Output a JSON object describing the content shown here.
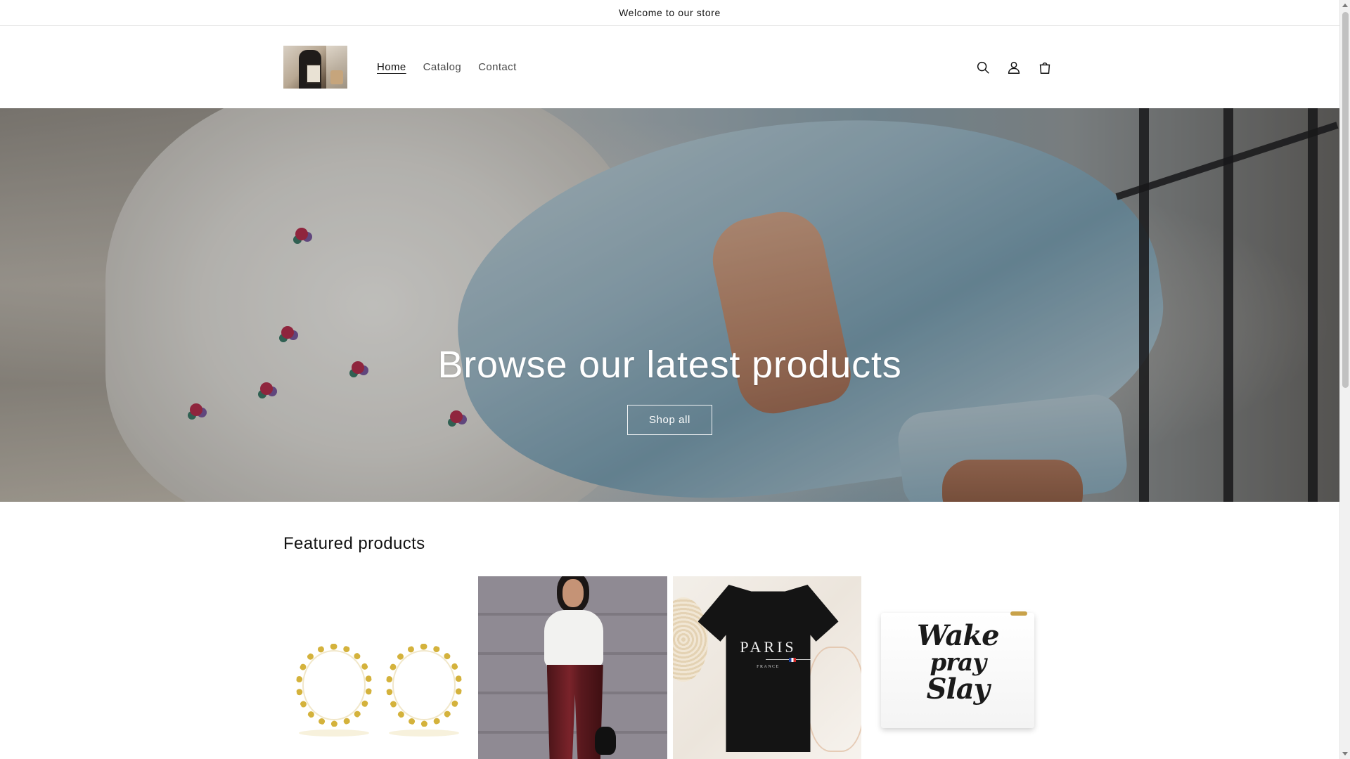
{
  "announcement": {
    "text": "Welcome to our store"
  },
  "header": {
    "logo_alt": "Store logo",
    "nav": [
      {
        "label": "Home",
        "active": true
      },
      {
        "label": "Catalog",
        "active": false
      },
      {
        "label": "Contact",
        "active": false
      }
    ],
    "icons": [
      "search-icon",
      "account-icon",
      "cart-icon"
    ]
  },
  "hero": {
    "title": "Browse our latest products",
    "button_label": "Shop all"
  },
  "featured": {
    "title": "Featured products",
    "products": [
      {
        "image": "gold-hoop-earrings"
      },
      {
        "image": "model-red-leather-pants"
      },
      {
        "image": "paris-black-tshirt",
        "print_main": "PARIS",
        "print_sub": "FRANCE"
      },
      {
        "image": "wake-pray-slay-pouch",
        "print_lines": [
          "Wake",
          "pray",
          "Slay"
        ]
      }
    ]
  },
  "colors": {
    "text": "#121212",
    "muted": "#4a4a4a",
    "accent_gold": "#d4b23c",
    "pants_red": "#7a232a"
  }
}
